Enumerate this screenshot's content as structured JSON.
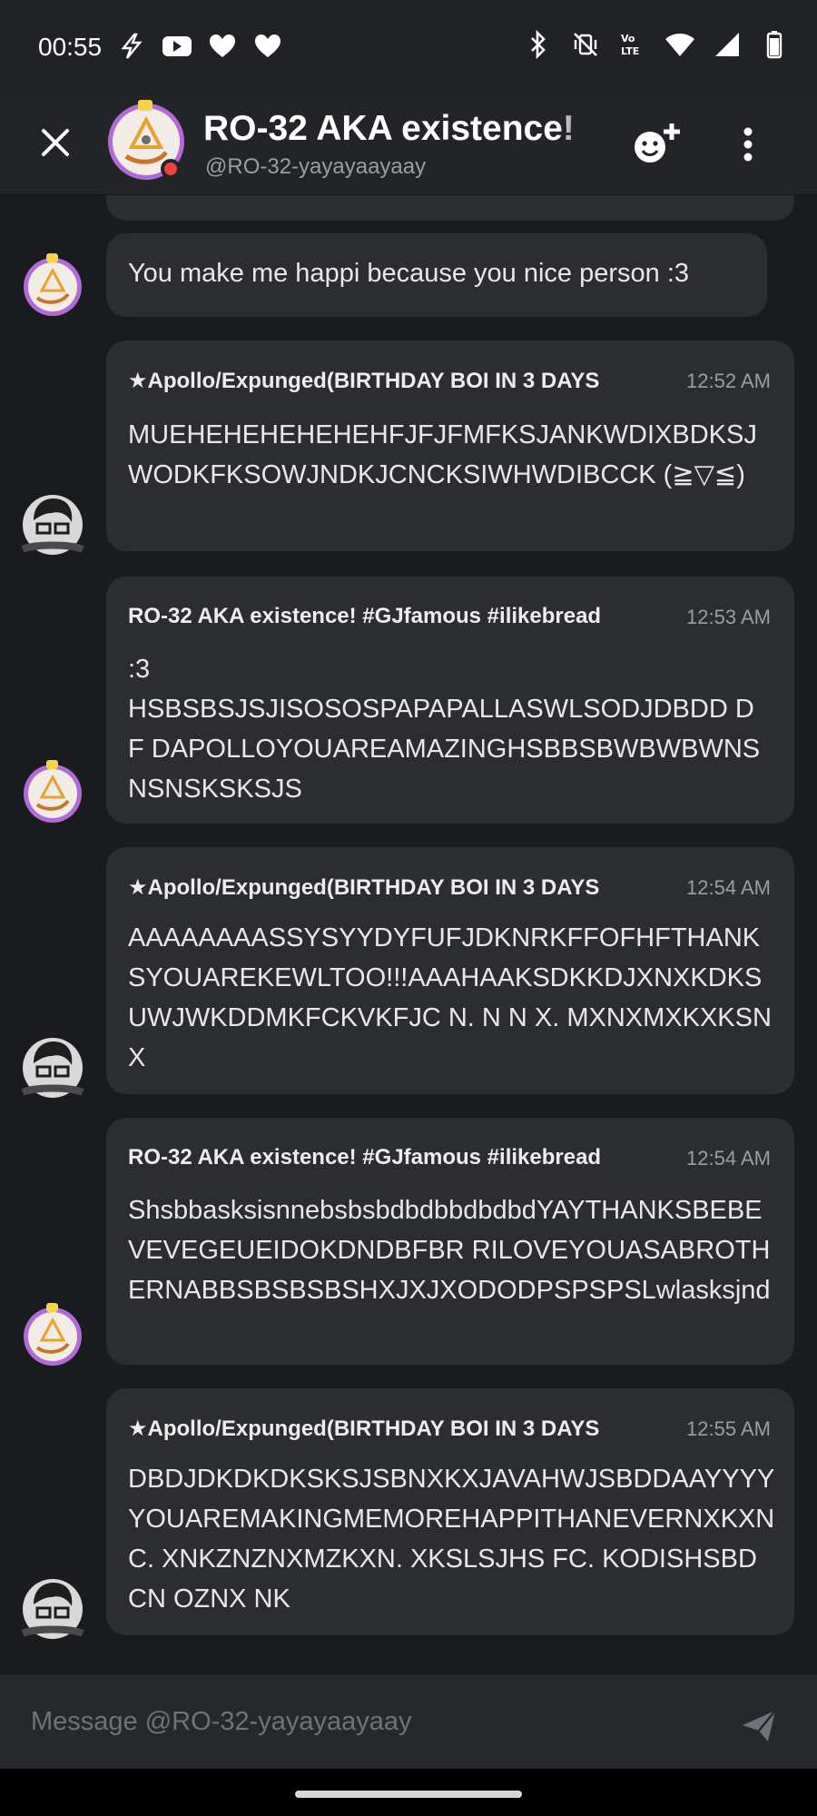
{
  "status_bar": {
    "time": "00:55",
    "left_icons": [
      "bolt-icon",
      "youtube-icon",
      "heart-icon",
      "heart-icon"
    ],
    "right_icons": [
      "bluetooth-icon",
      "vibrate-off-icon",
      "volte-icon",
      "wifi-icon",
      "signal-icon",
      "battery-icon"
    ],
    "volte_label": "Vo LTE"
  },
  "header": {
    "title": "RO-32 AKA existence!",
    "username": "@RO-32-yayayaayaay",
    "status_color": "#ed4245"
  },
  "messages": [
    {
      "author": "",
      "time": "",
      "text": "You make me happi because you nice person :3",
      "avatar": "ro32"
    },
    {
      "author": "★Apollo/Expunged(BIRTHDAY BOI IN 3 DAYS",
      "time": "12:52 AM",
      "text": "MUEHEHEHEHEHEHFJFJFMFKSJANKWDIXBDKSJWODKFKSOWJNDKJCNCKSIWHWDIBCCK (≧▽≦)",
      "avatar": "apollo"
    },
    {
      "author": "RO-32 AKA existence!  #GJfamous #ilikebread",
      "time": "12:53 AM",
      "text": ":3\nHSBSBSJSJISOSOSPAPAPALLASWLSODJDBDD D F DAPOLLOYOUAREAMAZINGHSBBSBWBWBWNSNSNSKSKSJS",
      "avatar": "ro32"
    },
    {
      "author": "★Apollo/Expunged(BIRTHDAY BOI IN 3 DAYS",
      "time": "12:54 AM",
      "text": "AAAAAAAASSYSYYDYFUFJDKNRKFFOFHFTHANKSYOUAREKEWLTOO!!!AAAHAAKSDKKDJXNXKDKSUWJWKDDMKFCKVKFJC N.  N N X.  MXNXMXKXKSNX",
      "avatar": "apollo"
    },
    {
      "author": "RO-32 AKA existence!  #GJfamous #ilikebread",
      "time": "12:54 AM",
      "text": "ShsbbasksisnnebsbsbdbdbbdbdbdYAYTHANKSBEBEVEVEGEUEIDOKDNDBFBR RILOVEYOUASABROTHERNABBSBSBSBSHXJXJXODODPSPSPSLwlasksjnd",
      "avatar": "ro32"
    },
    {
      "author": "★Apollo/Expunged(BIRTHDAY BOI IN 3 DAYS",
      "time": "12:55 AM",
      "text": "DBDJDKDKDKSKSJSBNXKXJAVAHWJSBDDAAYYYYYOUAREMAKINGMEMOREHAPPITHANEVERNXKXNC.   XNKZNZNXMZKXN. XKSLSJHS FC. KODISHSBD CN OZNX NK",
      "avatar": "apollo"
    }
  ],
  "composer": {
    "placeholder": "Message @RO-32-yayayaayaay"
  },
  "colors": {
    "background": "#1a1b1e",
    "bubble": "#2b2d31",
    "header": "#222428",
    "ro32_ring": "#b26bd6"
  }
}
